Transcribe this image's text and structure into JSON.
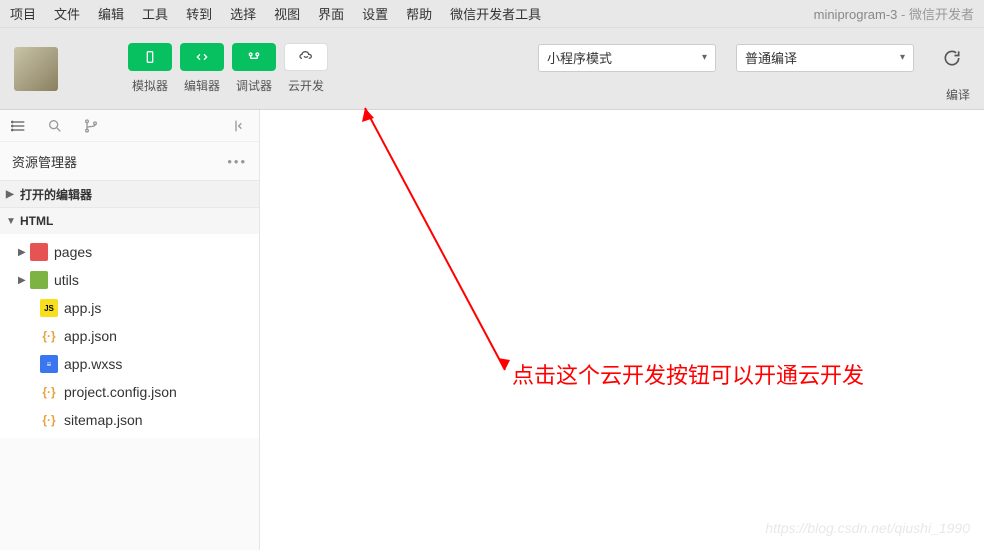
{
  "menubar": {
    "items": [
      "项目",
      "文件",
      "编辑",
      "工具",
      "转到",
      "选择",
      "视图",
      "界面",
      "设置",
      "帮助",
      "微信开发者工具"
    ],
    "project_name": "miniprogram-3",
    "app_name": "微信开发者"
  },
  "toolbar": {
    "buttons": [
      {
        "label": "模拟器",
        "icon": "phone",
        "style": "green"
      },
      {
        "label": "编辑器",
        "icon": "code",
        "style": "green"
      },
      {
        "label": "调试器",
        "icon": "debug",
        "style": "green"
      },
      {
        "label": "云开发",
        "icon": "cloud",
        "style": "white"
      }
    ],
    "mode_select": "小程序模式",
    "compile_select": "普通编译",
    "compile_label": "编译"
  },
  "sidebar": {
    "panel_title": "资源管理器",
    "sections": {
      "open_editors": "打开的编辑器",
      "project_root": "HTML"
    },
    "tree": [
      {
        "type": "folder",
        "icon": "fd-red",
        "name": "pages",
        "depth": 1,
        "arrow": "▶"
      },
      {
        "type": "folder",
        "icon": "fd-green",
        "name": "utils",
        "depth": 1,
        "arrow": "▶"
      },
      {
        "type": "file",
        "icon": "js",
        "glyph": "JS",
        "name": "app.js",
        "depth": 2
      },
      {
        "type": "file",
        "icon": "json",
        "glyph": "{·}",
        "name": "app.json",
        "depth": 2
      },
      {
        "type": "file",
        "icon": "wxss",
        "glyph": "≡",
        "name": "app.wxss",
        "depth": 2
      },
      {
        "type": "file",
        "icon": "json",
        "glyph": "{·}",
        "name": "project.config.json",
        "depth": 2
      },
      {
        "type": "file",
        "icon": "json",
        "glyph": "{·}",
        "name": "sitemap.json",
        "depth": 2
      }
    ]
  },
  "annotation": {
    "text": "点击这个云开发按钮可以开通云开发"
  },
  "watermark": "https://blog.csdn.net/qiushi_1990"
}
